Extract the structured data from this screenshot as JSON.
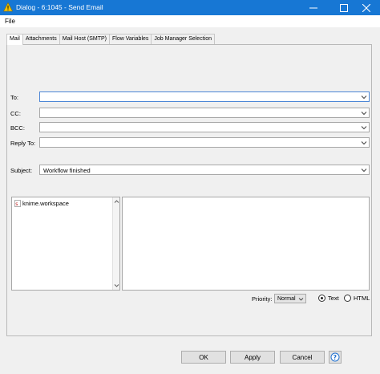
{
  "window": {
    "title": "Dialog - 6:1045 - Send Email"
  },
  "menu": {
    "file": "File"
  },
  "tabs": [
    {
      "label": "Mail",
      "active": true
    },
    {
      "label": "Attachments",
      "active": false
    },
    {
      "label": "Mail Host (SMTP)",
      "active": false
    },
    {
      "label": "Flow Variables",
      "active": false
    },
    {
      "label": "Job Manager Selection",
      "active": false
    }
  ],
  "mail": {
    "to_label": "To:",
    "to_value": "",
    "cc_label": "CC:",
    "cc_value": "",
    "bcc_label": "BCC:",
    "bcc_value": "",
    "reply_to_label": "Reply To:",
    "reply_to_value": "",
    "subject_label": "Subject:",
    "subject_value": "Workflow finished",
    "variables": [
      "knime.workspace"
    ],
    "body_text": "",
    "priority_label": "Priority:",
    "priority_value": "Normal",
    "format_text_label": "Text",
    "format_html_label": "HTML",
    "format_selected": "Text"
  },
  "buttons": {
    "ok": "OK",
    "apply": "Apply",
    "cancel": "Cancel"
  },
  "colors": {
    "titlebar": "#1777d4",
    "focus_border": "#4c86d6",
    "dialog_bg": "#f0f0f0"
  },
  "icons": {
    "app": "warning-triangle-icon",
    "minimize": "minimize-icon",
    "maximize": "maximize-icon",
    "close": "close-icon",
    "variable": "flow-variable-icon",
    "help": "help-icon"
  }
}
